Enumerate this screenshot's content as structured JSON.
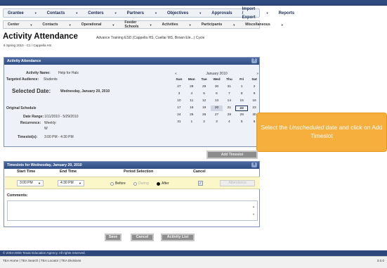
{
  "menu1": {
    "items": [
      "Grantee",
      "Contacts",
      "Centers",
      "Partners",
      "Objectives",
      "Approvals",
      "Import / Export",
      "Reports"
    ],
    "has_dropdown": [
      true,
      true,
      true,
      true,
      true,
      false,
      true,
      false
    ]
  },
  "menu2": {
    "items": [
      "Center",
      "Contacts",
      "Operational",
      "Feeder Schools",
      "Activities",
      "Participants",
      "Miscellaneous"
    ]
  },
  "page": {
    "title": "Activity Attendance",
    "subtitle": "Advance Training ESD (Cappella HS, Cuellar MS, Brown Ele...) Cycle",
    "crumb": "6 Spring 2010 - C1 / Cappella HS"
  },
  "activity_panel": {
    "header": "Activity Attendance",
    "activity_name_label": "Activity Name:",
    "activity_name": "Help for Hals",
    "targeted_label": "Targeted Audience:",
    "targeted": "Students",
    "selected_date_label": "Selected Date:",
    "selected_date": "Wednesday, January 20, 2010",
    "original_schedule_label": "Original Schedule",
    "date_range_label": "Date Range:",
    "date_range": "1/11/2010 - 5/29/2010",
    "recurrence_label": "Recurrence:",
    "recurrence_1": "Weekly:",
    "recurrence_2": "W",
    "timeslots_label": "Timeslot(s):",
    "timeslots": "3:00 PM - 4:30 PM"
  },
  "calendar": {
    "prev": "«",
    "month": "January 2010",
    "next": "»",
    "weekdays": [
      "Sun",
      "Mon",
      "Tue",
      "Wed",
      "Thu",
      "Fri",
      "Sat"
    ],
    "days": [
      "27",
      "28",
      "29",
      "30",
      "31",
      "1",
      "2",
      "3",
      "4",
      "5",
      "6",
      "7",
      "8",
      "9",
      "10",
      "11",
      "12",
      "13",
      "14",
      "15",
      "16",
      "17",
      "18",
      "19",
      "20",
      "21",
      "22",
      "23",
      "24",
      "25",
      "26",
      "27",
      "28",
      "29",
      "30",
      "31",
      "1",
      "2",
      "3",
      "4",
      "5",
      "6"
    ],
    "selected_index": 24,
    "today_index": 26
  },
  "callout": {
    "pre": "Select the ",
    "em": "Unscheduled",
    "post": " date and click on Add Timeslot"
  },
  "add_timeslot_label": "Add Timeslot",
  "timeslot_panel": {
    "header": "Timeslots for Wednesday, January 20, 2010",
    "col_start": "Start Time",
    "col_end": "End Time",
    "col_period": "Period Selection",
    "col_cancel": "Cancel",
    "start_time": "3:00 PM",
    "end_time": "4:30 PM",
    "period_before": "Before",
    "period_during": "During",
    "period_after": "After",
    "attendance_label": "Attendance",
    "comments_label": "Comments:"
  },
  "buttons": {
    "save": "Save",
    "cancel": "Cancel",
    "activity_list": "Activity List"
  },
  "footer": {
    "copyright": "© 2004-2009 Texas Education Agency. All rights reserved.",
    "links": "TEA Home | TEA Search | TEA Locator | TEA Divisions",
    "version": "3.0.0"
  }
}
